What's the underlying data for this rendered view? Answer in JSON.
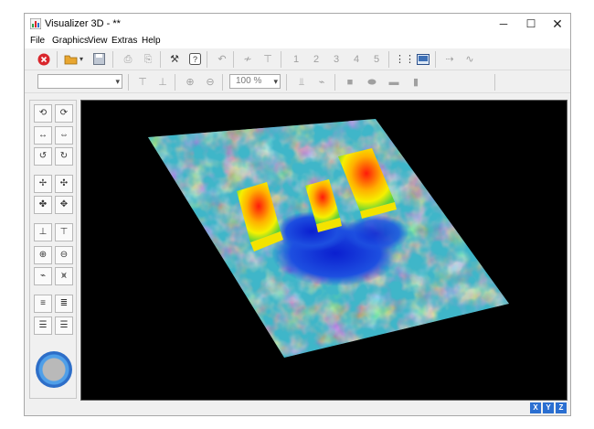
{
  "window": {
    "title": "Visualizer 3D - **"
  },
  "window_controls": {
    "minimize": "─",
    "maximize": "☐",
    "close": "✕"
  },
  "menu": [
    "File",
    "Graphics",
    "View",
    "Extras",
    "Help"
  ],
  "toolbar1": {
    "layer_numbers": [
      "1",
      "2",
      "3",
      "4",
      "5"
    ]
  },
  "toolbar2": {
    "layer_combo": "",
    "zoom_combo": "100 %"
  },
  "statusbar": {
    "axes": [
      "X",
      "Y",
      "Z"
    ]
  },
  "colors": {
    "stop_icon": "#d9262c",
    "open_icon": "#e8a630",
    "axis_button": "#2b6fd1",
    "viewport_bg": "#000000",
    "surface_low": "#1438d6",
    "surface_mid": "#2fc84a",
    "surface_high": "#ff1a0a"
  },
  "icons": {
    "toolbar1": [
      "stop-icon",
      "open-folder-icon",
      "dropdown-arrow-icon",
      "save-icon",
      "export-icon",
      "print-icon",
      "tools-icon",
      "help-icon",
      "undo-icon",
      "curve-icon",
      "pin-icon",
      "grid-icon",
      "image-icon",
      "move-icon",
      "graph-icon"
    ],
    "toolbar2": [
      "align-top-icon",
      "align-bottom-icon",
      "zoom-in-icon",
      "zoom-out-icon",
      "sensor-icon",
      "wave-icon",
      "square-icon",
      "ellipse-icon",
      "line-icon",
      "bar-icon"
    ],
    "left_panel": [
      "rotate-up-icon",
      "rotate-down-icon",
      "rotate-left-icon",
      "rotate-right-icon",
      "rotate-ccw-icon",
      "rotate-cw-icon",
      "move-left-icon",
      "move-right-icon",
      "move-up-icon",
      "move-down-icon",
      "lower-icon",
      "raise-icon",
      "zoom-in-icon",
      "zoom-out-icon",
      "scale-down-icon",
      "scale-up-icon",
      "spread-icon",
      "compress-icon",
      "align-left-icon",
      "align-right-icon",
      "rotation-dial-icon"
    ]
  }
}
